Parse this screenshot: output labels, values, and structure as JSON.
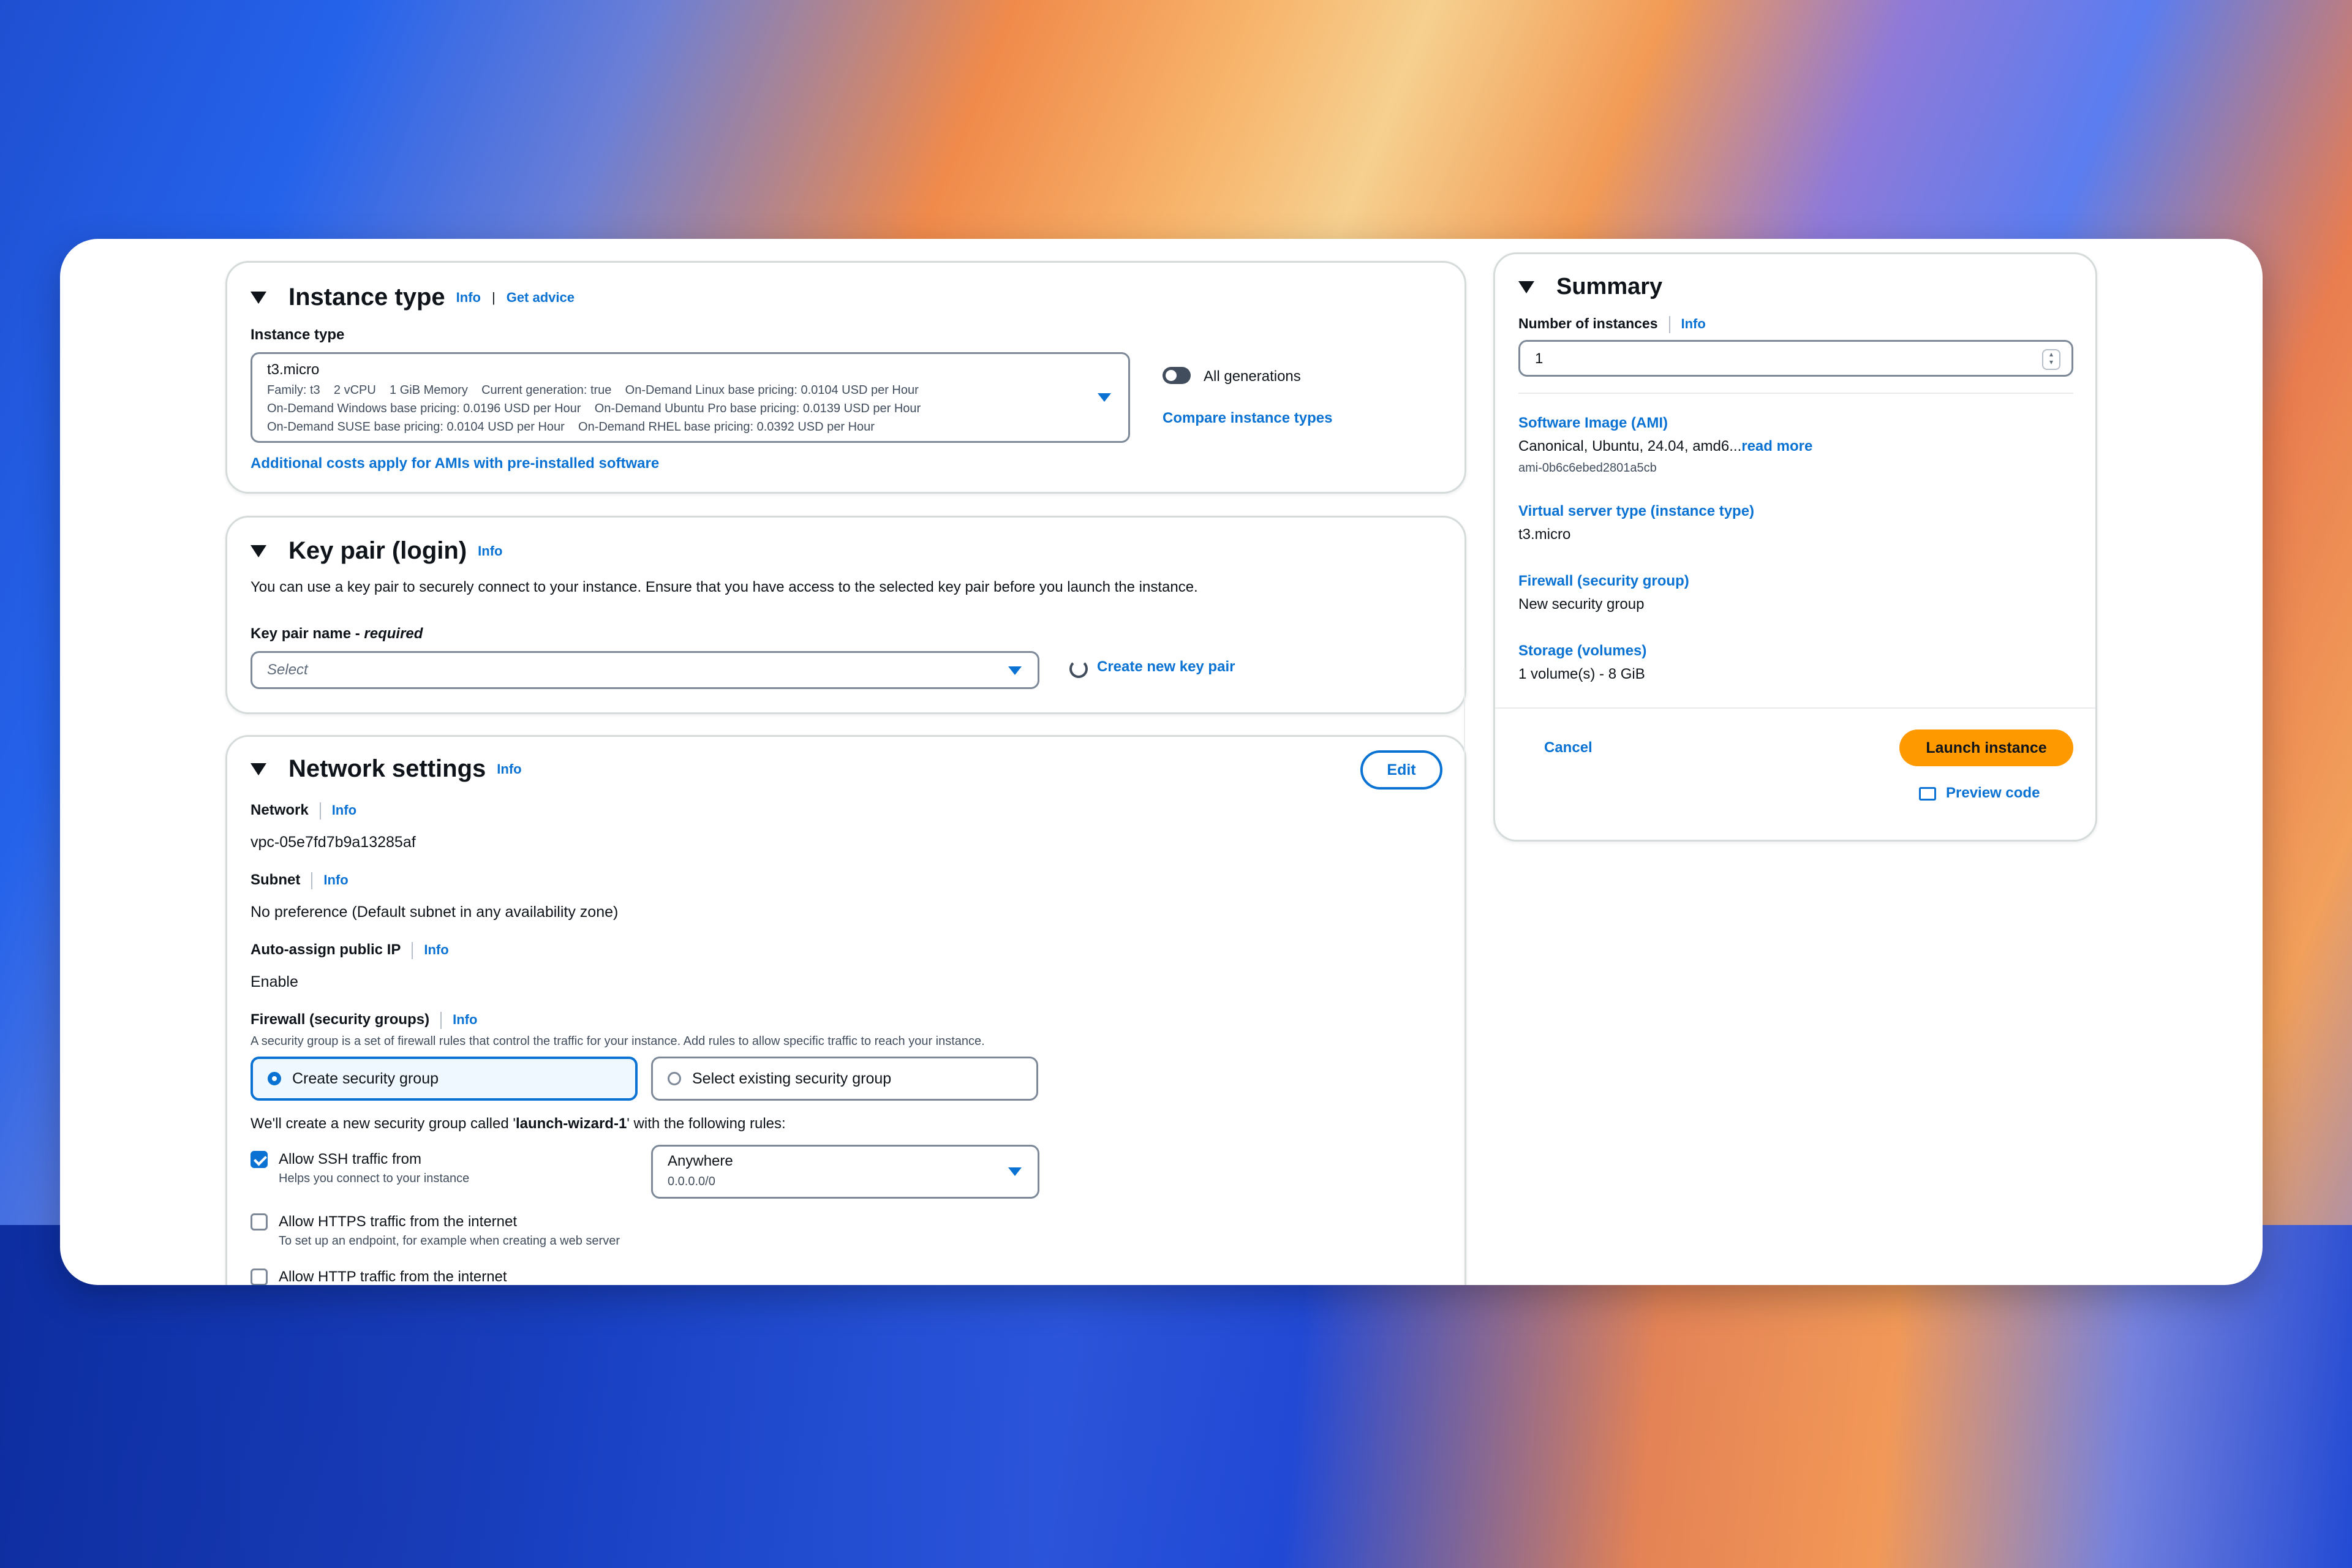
{
  "instance_type": {
    "title": "Instance type",
    "info": "Info",
    "get_advice": "Get advice",
    "field_label": "Instance type",
    "selected": "t3.micro",
    "details_line1": "Family: t3    2 vCPU    1 GiB Memory    Current generation: true    On-Demand Linux base pricing: 0.0104 USD per Hour",
    "details_line2": "On-Demand Windows base pricing: 0.0196 USD per Hour    On-Demand Ubuntu Pro base pricing: 0.0139 USD per Hour",
    "details_line3": "On-Demand SUSE base pricing: 0.0104 USD per Hour    On-Demand RHEL base pricing: 0.0392 USD per Hour",
    "all_generations": "All generations",
    "compare": "Compare instance types",
    "additional_costs": "Additional costs apply for AMIs with pre-installed software"
  },
  "key_pair": {
    "title": "Key pair (login)",
    "info": "Info",
    "description": "You can use a key pair to securely connect to your instance. Ensure that you have access to the selected key pair before you launch the instance.",
    "field_label": "Key pair name - ",
    "required": "required",
    "placeholder": "Select",
    "create_new": "Create new key pair"
  },
  "network": {
    "title": "Network settings",
    "info": "Info",
    "edit": "Edit",
    "network_label": "Network",
    "network_value": "vpc-05e7fd7b9a13285af",
    "subnet_label": "Subnet",
    "subnet_value": "No preference (Default subnet in any availability zone)",
    "public_ip_label": "Auto-assign public IP",
    "public_ip_value": "Enable",
    "firewall_label": "Firewall (security groups)",
    "firewall_desc": "A security group is a set of firewall rules that control the traffic for your instance. Add rules to allow specific traffic to reach your instance.",
    "create_sg": "Create security group",
    "select_sg": "Select existing security group",
    "sg_note_pre": "We'll create a new security group called '",
    "sg_name": "launch-wizard-1",
    "sg_note_post": "' with the following rules:",
    "ssh_label": "Allow SSH traffic from",
    "ssh_help": "Helps you connect to your instance",
    "ssh_source": "Anywhere",
    "ssh_cidr": "0.0.0.0/0",
    "https_label": "Allow HTTPS traffic from the internet",
    "https_help": "To set up an endpoint, for example when creating a web server",
    "http_label": "Allow HTTP traffic from the internet"
  },
  "summary": {
    "title": "Summary",
    "num_label": "Number of instances",
    "info": "Info",
    "num_value": "1",
    "ami_label": "Software Image (AMI)",
    "ami_value": "Canonical, Ubuntu, 24.04, amd6...",
    "read_more": "read more",
    "ami_id": "ami-0b6c6ebed2801a5cb",
    "vtype_label": "Virtual server type (instance type)",
    "vtype_value": "t3.micro",
    "firewall_label": "Firewall (security group)",
    "firewall_value": "New security group",
    "storage_label": "Storage (volumes)",
    "storage_value": "1 volume(s) - 8 GiB",
    "cancel": "Cancel",
    "launch": "Launch instance",
    "preview": "Preview code"
  }
}
